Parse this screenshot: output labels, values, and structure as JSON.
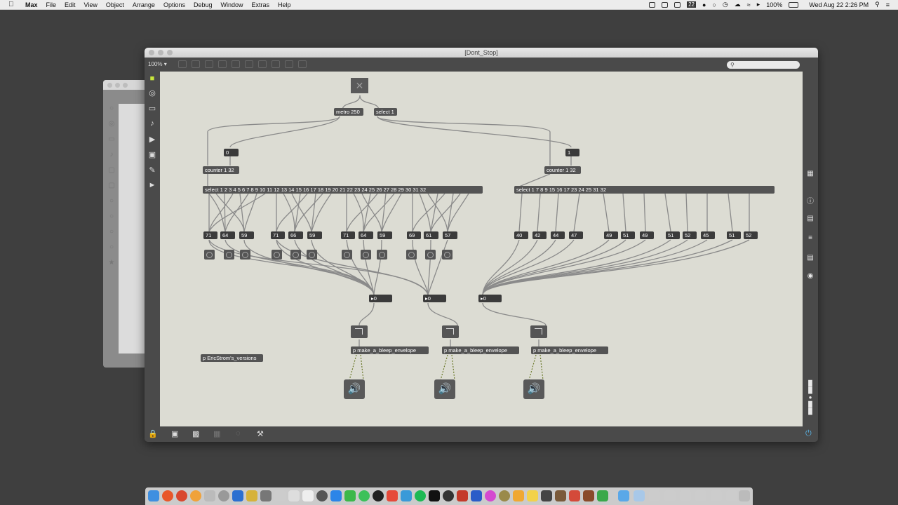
{
  "menubar": {
    "apple": "",
    "app": "Max",
    "items": [
      "File",
      "Edit",
      "View",
      "Object",
      "Arrange",
      "Options",
      "Debug",
      "Window",
      "Extras",
      "Help"
    ],
    "badge": "22",
    "battery": "100%",
    "clock": "Wed Aug 22  2:26 PM"
  },
  "window": {
    "title": "[Dont_Stop]",
    "zoom": "100%",
    "search_placeholder": ""
  },
  "patch": {
    "metro": "metro 250",
    "select1": "select 1",
    "msg_left": "0",
    "msg_right": "1",
    "counter_left": "counter 1 32",
    "counter_right": "counter 1 32",
    "select_left": "select 1 2 3 4 5 6 7 8 9 10 11 12 13 14 15 16 17 18 19 20 21 22 23 24 25 26 27 28 29 30 31 32",
    "select_right": "select 1 7 8 9 15 16 17 23 24 25 31 32",
    "left_numbers": [
      "71",
      "64",
      "59",
      "71",
      "66",
      "59",
      "71",
      "64",
      "59",
      "69",
      "61",
      "57"
    ],
    "right_numbers": [
      "40",
      "42",
      "44",
      "47",
      "49",
      "51",
      "49",
      "51",
      "52",
      "45",
      "51",
      "52"
    ],
    "floats": [
      "0",
      "0",
      "0"
    ],
    "bleep": "p make_a_bleep_envelope",
    "versions": "p EricStrom's_versions"
  },
  "colors": {
    "canvas": "#dcdcd3",
    "object": "#545454",
    "cord": "#8a8a8a"
  }
}
